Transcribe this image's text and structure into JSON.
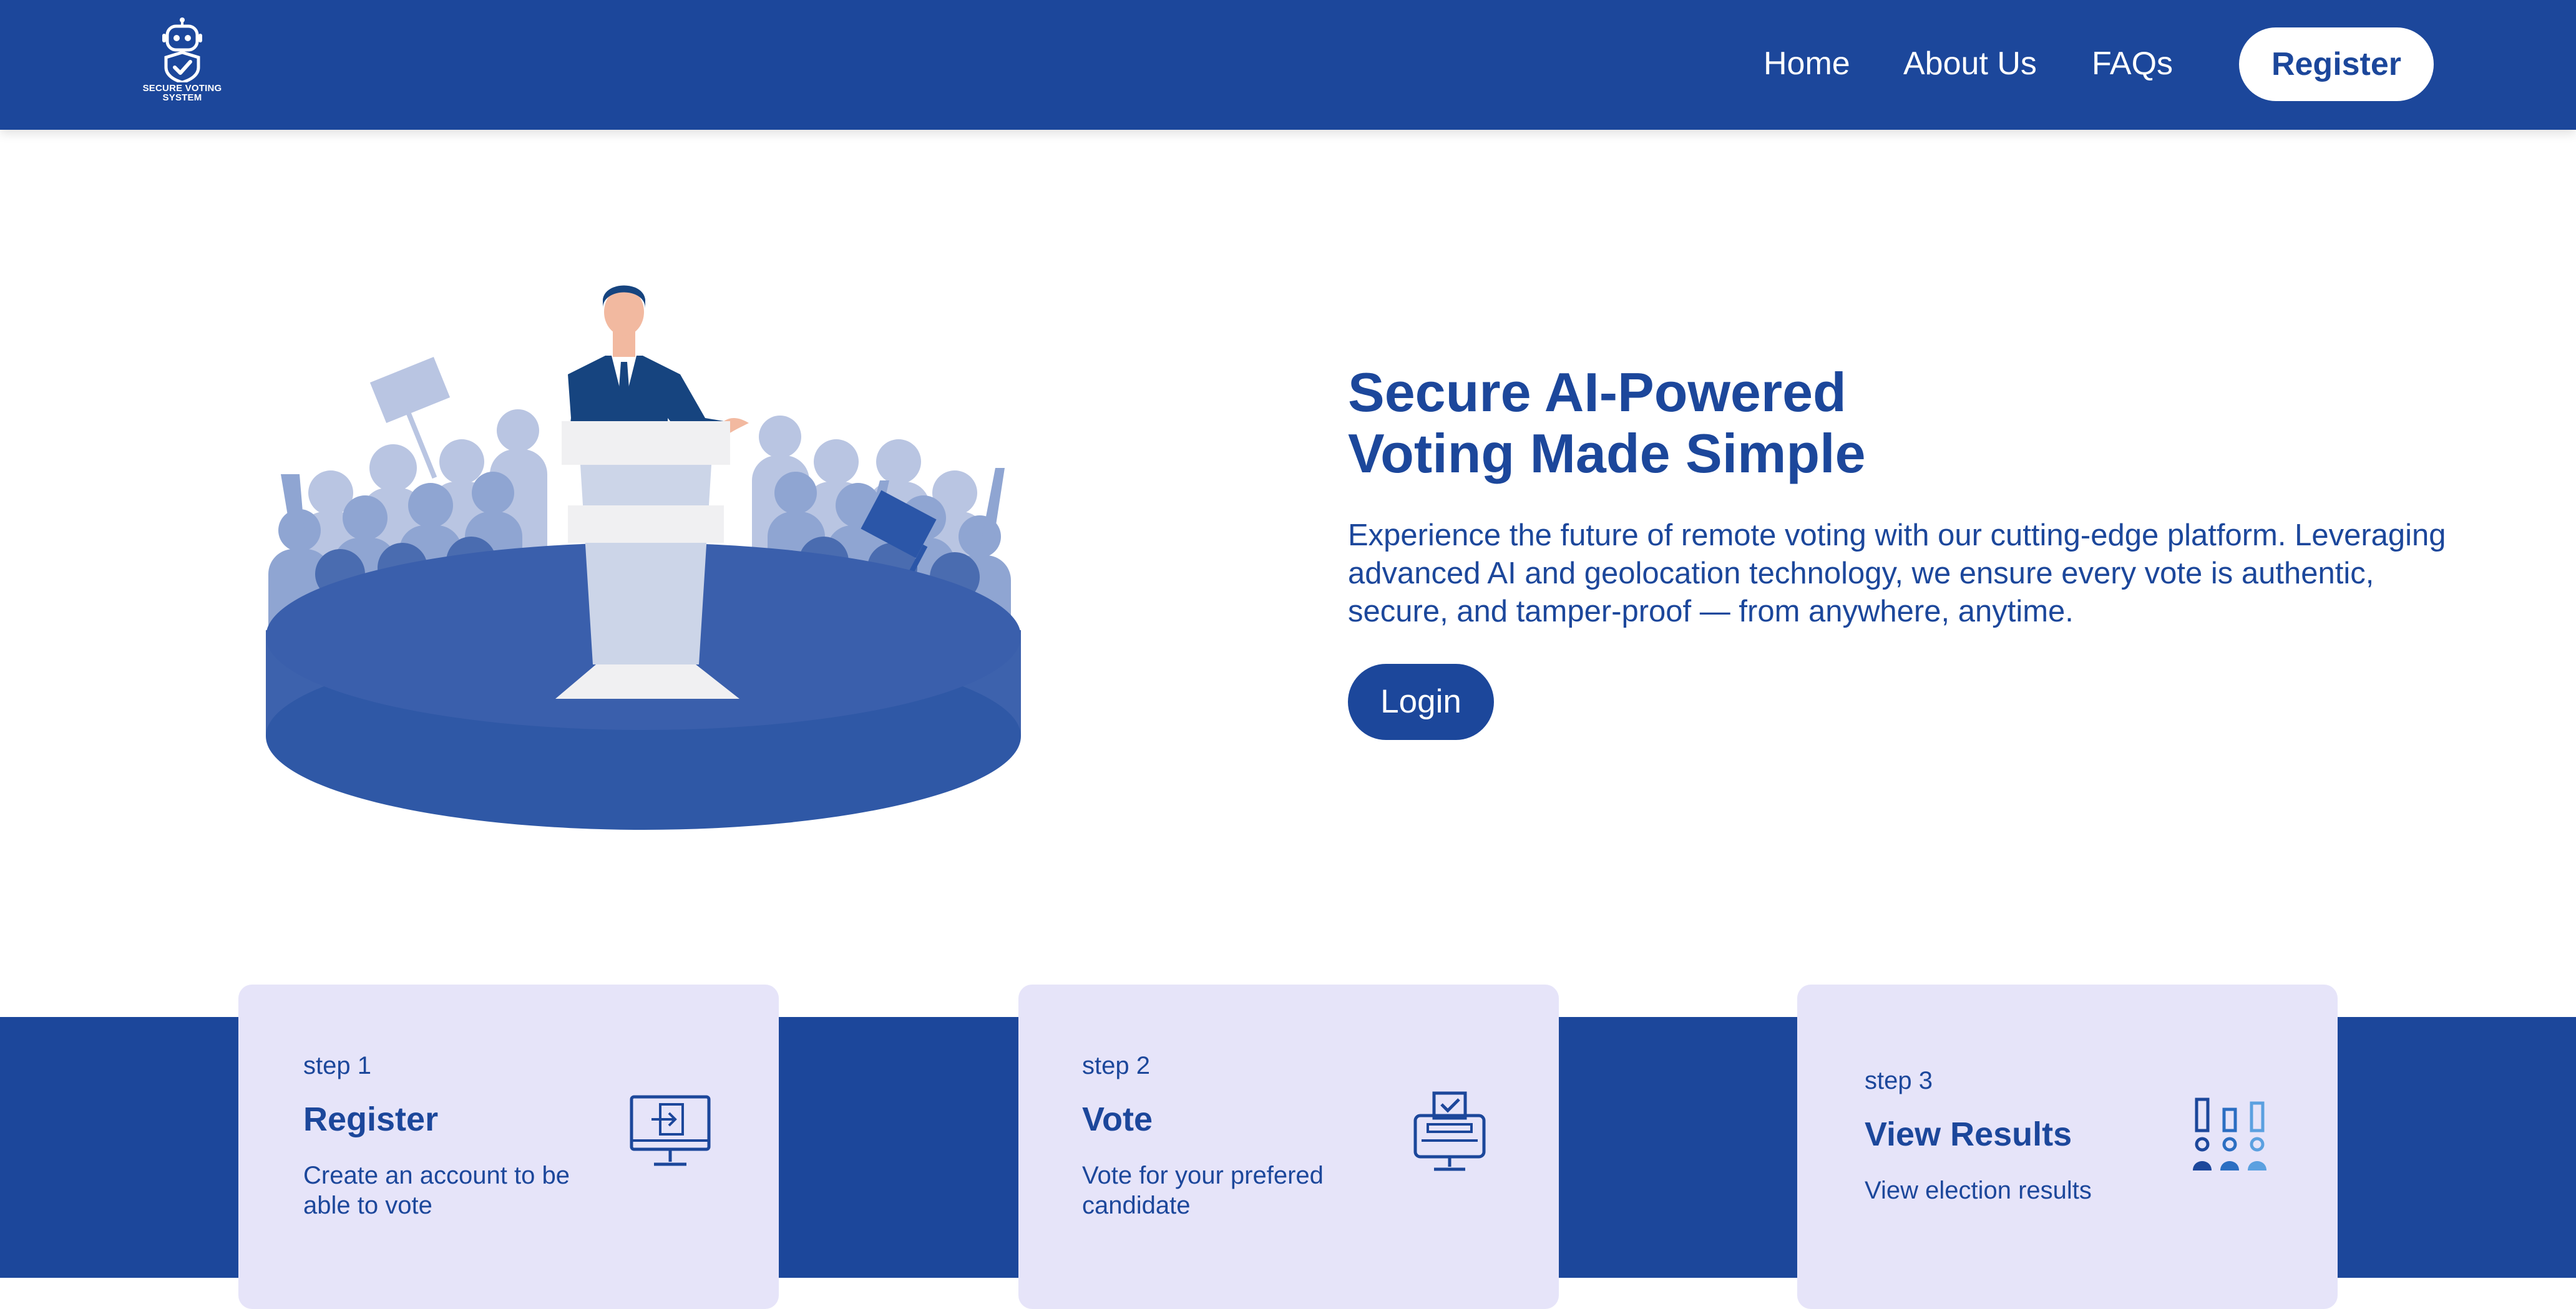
{
  "brand": {
    "logo_text_line1": "SECURE VOTING",
    "logo_text_line2": "SYSTEM",
    "icon": "robot-shield-check-icon"
  },
  "nav": {
    "links": [
      "Home",
      "About Us",
      "FAQs"
    ],
    "register_label": "Register"
  },
  "hero": {
    "title_line1": "Secure AI-Powered",
    "title_line2": "Voting Made Simple",
    "description": "Experience the future of remote voting with our cutting-edge platform. Leveraging advanced AI and geolocation technology, we ensure every vote is authentic, secure, and tamper-proof — from anywhere, anytime.",
    "login_label": "Login",
    "illustration": "speaker-at-podium-crowd-illustration"
  },
  "steps": [
    {
      "label": "step 1",
      "title": "Register",
      "description": "Create an account to be able to vote",
      "icon": "monitor-login-icon"
    },
    {
      "label": "step 2",
      "title": "Vote",
      "description": "Vote for your prefered candidate",
      "icon": "ballot-box-computer-icon"
    },
    {
      "label": "step 3",
      "title": "View Results",
      "description": "View election results",
      "icon": "bar-chart-people-icon"
    }
  ],
  "colors": {
    "primary": "#1c479b",
    "card_background": "#e6e4f9",
    "white": "#ffffff"
  }
}
